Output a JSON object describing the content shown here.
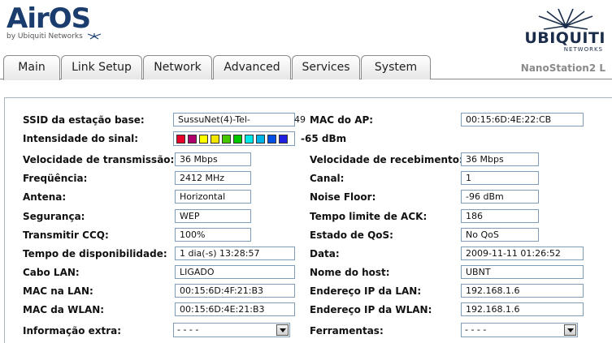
{
  "brand": {
    "product_logo": "AirOS",
    "product_byline": "by Ubiquiti Networks",
    "vendor_logo": "UBIQUITI",
    "vendor_sub": "NETWORKS",
    "device_name": "NanoStation2 L"
  },
  "tabs": [
    {
      "label": "Main",
      "active": true
    },
    {
      "label": "Link Setup",
      "active": false
    },
    {
      "label": "Network",
      "active": false
    },
    {
      "label": "Advanced",
      "active": false
    },
    {
      "label": "Services",
      "active": false
    },
    {
      "label": "System",
      "active": false
    }
  ],
  "status": {
    "ssid_label": "SSID da estação base:",
    "ssid_value": "SussuNet(4)-Tel-",
    "ssid_overflow": "49",
    "ap_mac_label": "MAC do AP:",
    "ap_mac_value": "00:15:6D:4E:22:CB",
    "signal_label": "Intensidade do sinal:",
    "signal_value": "-65 dBm",
    "signal_bar_colors": [
      "#e8002a",
      "#b0006e",
      "#ffff00",
      "#f2e600",
      "#46c800",
      "#00c800",
      "#00e8e8",
      "#00b4e8",
      "#0050e8",
      "#2020e0"
    ],
    "tx_rate_label": "Velocidade de transmissão:",
    "tx_rate_value": "36 Mbps",
    "rx_rate_label": "Velocidade de recebimento:",
    "rx_rate_value": "36 Mbps",
    "frequency_label": "Freqüência:",
    "frequency_value": "2412 MHz",
    "channel_label": "Canal:",
    "channel_value": "1",
    "antenna_label": "Antena:",
    "antenna_value": "Horizontal",
    "noise_label": "Noise Floor:",
    "noise_value": "-96 dBm",
    "security_label": "Segurança:",
    "security_value": "WEP",
    "ack_label": "Tempo limite de ACK:",
    "ack_value": "186",
    "ccq_label": "Transmitir CCQ:",
    "ccq_value": "100%",
    "qos_label": "Estado de QoS:",
    "qos_value": "No QoS",
    "uptime_label": "Tempo de disponibilidade:",
    "uptime_value": "1 dia(-s) 13:28:57",
    "date_label": "Data:",
    "date_value": "2009-11-11 01:26:52",
    "lan_cable_label": "Cabo LAN:",
    "lan_cable_value": "LIGADO",
    "hostname_label": "Nome do host:",
    "hostname_value": "UBNT",
    "lan_mac_label": "MAC na LAN:",
    "lan_mac_value": "00:15:6D:4F:21:B3",
    "lan_ip_label": "Endereço IP da LAN:",
    "lan_ip_value": "192.168.1.6",
    "wlan_mac_label": "MAC da WLAN:",
    "wlan_mac_value": "00:15:6D:4E:21:B3",
    "wlan_ip_label": "Endereço IP da WLAN:",
    "wlan_ip_value": "192.168.1.6",
    "extra_info_label": "Informação extra:",
    "extra_info_value": "- - - -",
    "tools_label": "Ferramentas:",
    "tools_value": "- - - -"
  },
  "icons": {
    "dropdown": "chevron-down-icon",
    "vendor": "antenna-burst-icon"
  }
}
